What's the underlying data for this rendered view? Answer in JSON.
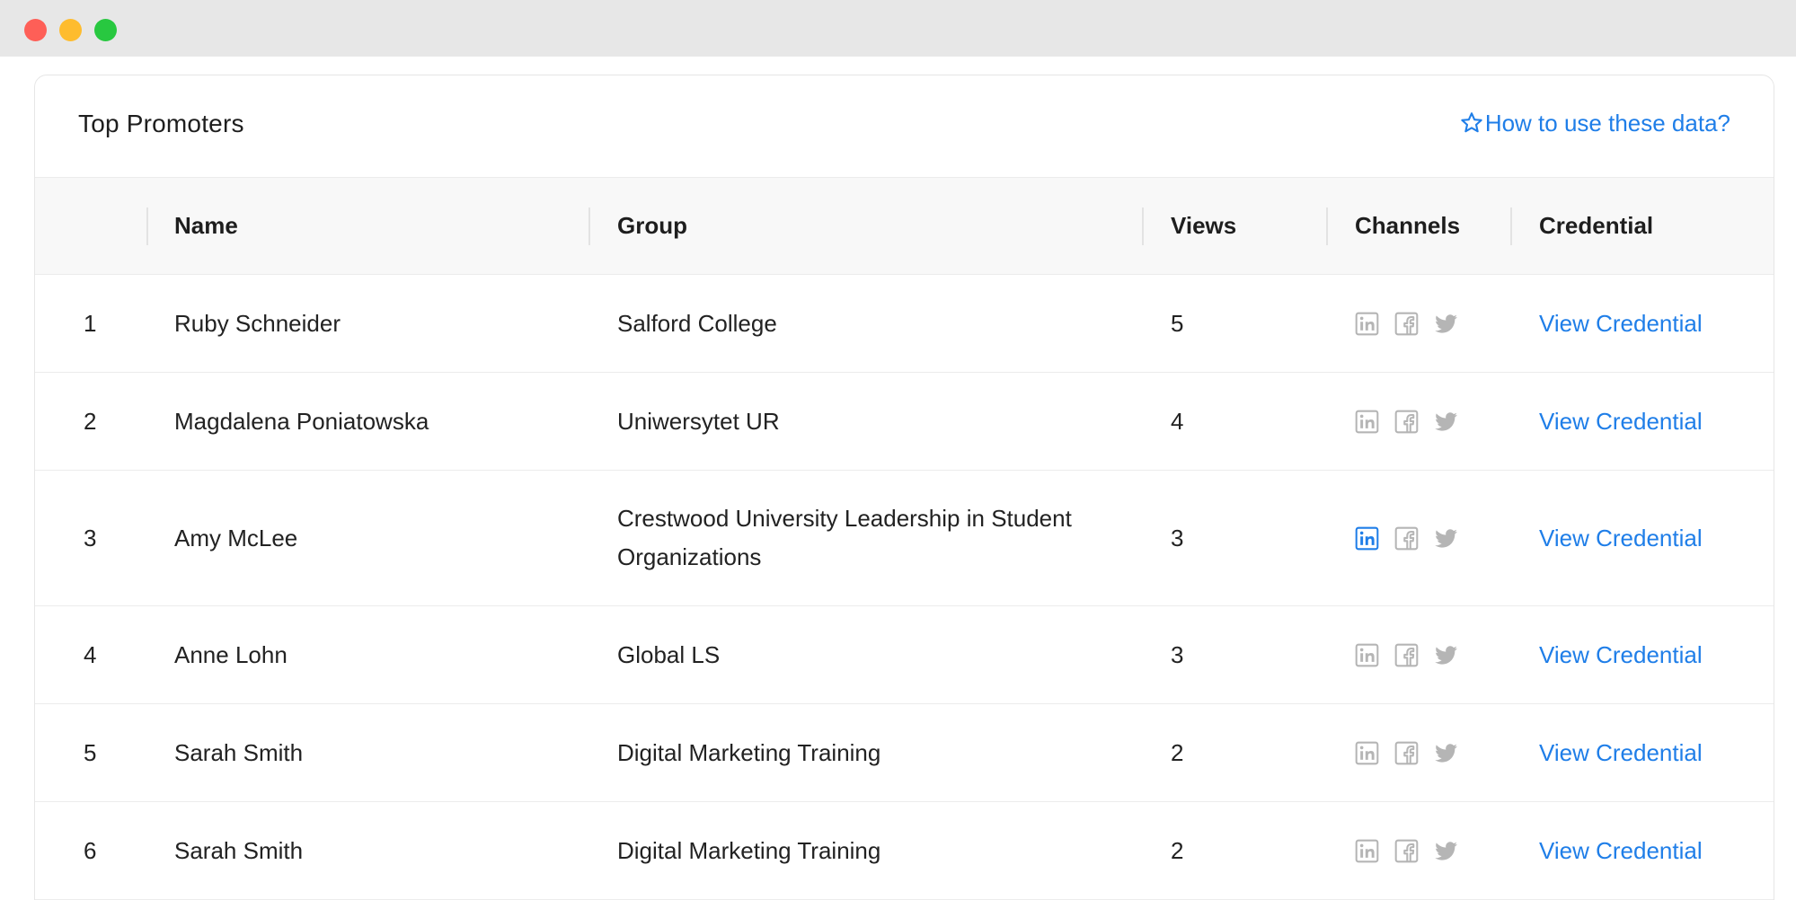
{
  "window": {
    "controls": [
      "close",
      "minimize",
      "maximize"
    ]
  },
  "card": {
    "title": "Top Promoters",
    "help_link": "How to use these data?"
  },
  "table": {
    "columns": {
      "rank": "",
      "name": "Name",
      "group": "Group",
      "views": "Views",
      "channels": "Channels",
      "credential": "Credential"
    },
    "rows": [
      {
        "rank": "1",
        "name": "Ruby Schneider",
        "group": "Salford College",
        "views": "5",
        "linkedin_active": false,
        "credential": "View Credential"
      },
      {
        "rank": "2",
        "name": "Magdalena Poniatowska",
        "group": "Uniwersytet UR",
        "views": "4",
        "linkedin_active": false,
        "credential": "View Credential"
      },
      {
        "rank": "3",
        "name": "Amy McLee",
        "group": "Crestwood University Leadership in Student Organizations",
        "views": "3",
        "linkedin_active": true,
        "credential": "View Credential"
      },
      {
        "rank": "4",
        "name": "Anne Lohn",
        "group": "Global LS",
        "views": "3",
        "linkedin_active": false,
        "credential": "View Credential"
      },
      {
        "rank": "5",
        "name": "Sarah Smith",
        "group": "Digital Marketing Training",
        "views": "2",
        "linkedin_active": false,
        "credential": "View Credential"
      },
      {
        "rank": "6",
        "name": "Sarah Smith",
        "group": "Digital Marketing Training",
        "views": "2",
        "linkedin_active": false,
        "credential": "View Credential"
      }
    ]
  },
  "colors": {
    "link": "#1f7ee8",
    "icon_inactive": "#b5b5b5",
    "icon_active": "#1f7ee8"
  },
  "icons": [
    "star-icon",
    "linkedin-icon",
    "facebook-icon",
    "twitter-icon"
  ]
}
